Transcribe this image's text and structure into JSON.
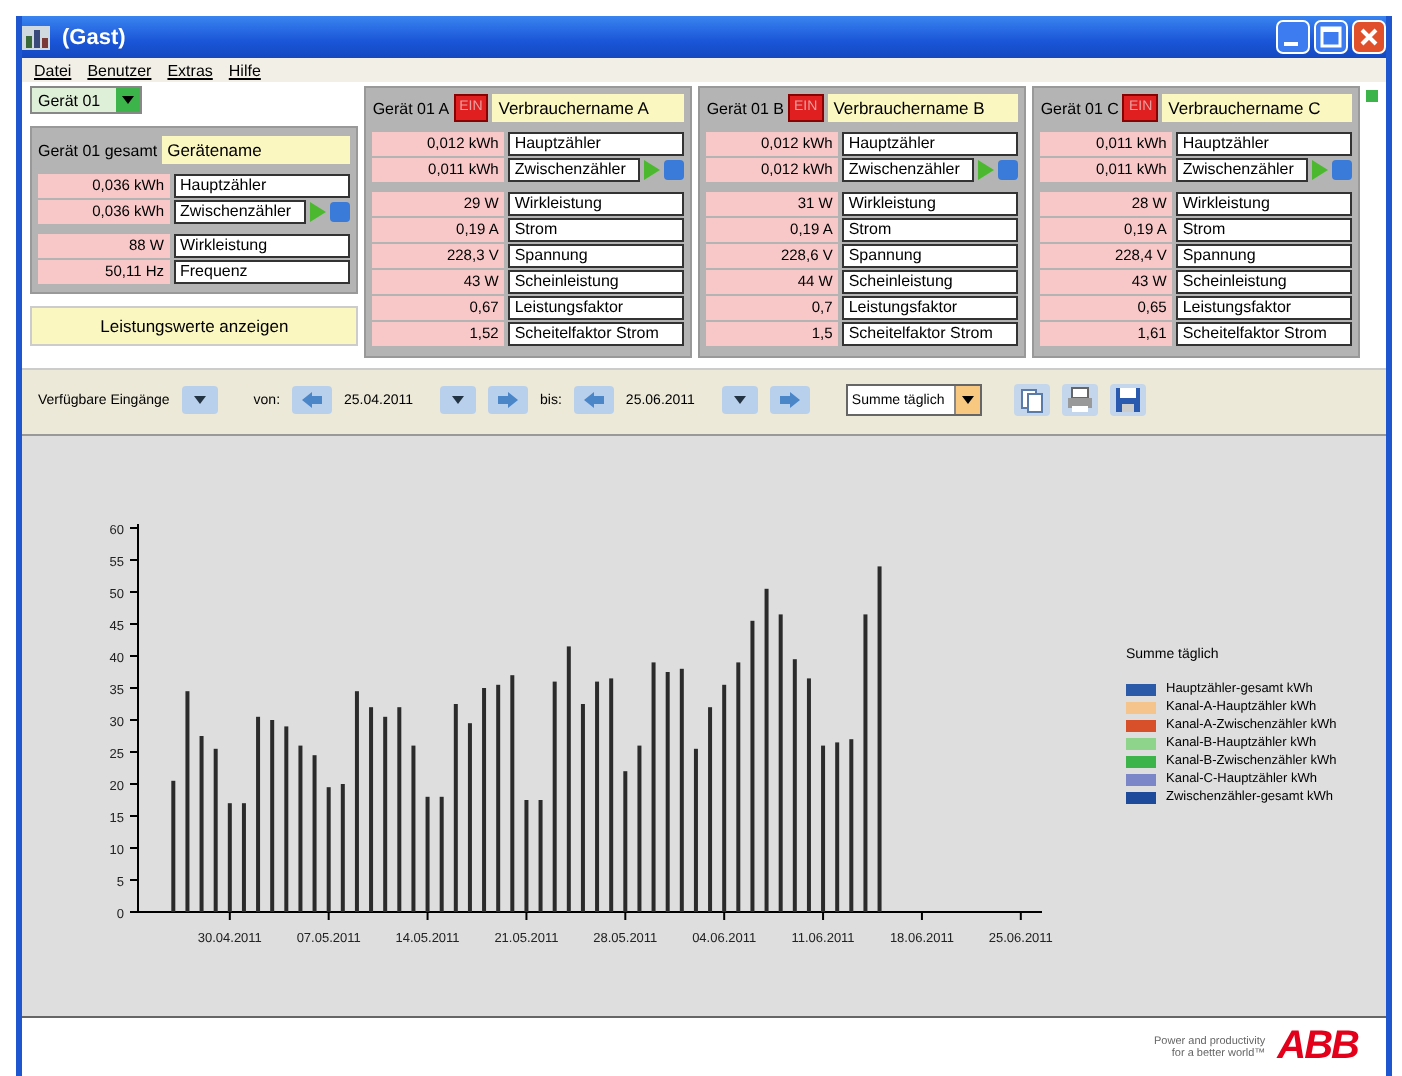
{
  "window": {
    "title": "(Gast)"
  },
  "menu": [
    "Datei",
    "Benutzer",
    "Extras",
    "Hilfe"
  ],
  "device_select": {
    "value": "Gerät 01"
  },
  "total_panel": {
    "label": "Gerät 01 gesamt",
    "name": "Gerätename",
    "counters": [
      {
        "value": "0,036 kWh",
        "label": "Hauptzähler",
        "kind": "plain"
      },
      {
        "value": "0,036 kWh",
        "label": "Zwischenzähler",
        "kind": "resettable"
      }
    ],
    "measurements": [
      {
        "value": "88 W",
        "label": "Wirkleistung"
      },
      {
        "value": "50,11 Hz",
        "label": "Frequenz"
      }
    ],
    "button": "Leistungswerte anzeigen"
  },
  "channel_panels": [
    {
      "label": "Gerät 01 A",
      "status": "EIN",
      "on": true,
      "name": "Verbrauchername A",
      "counters": [
        {
          "value": "0,012 kWh",
          "label": "Hauptzähler",
          "kind": "plain"
        },
        {
          "value": "0,011 kWh",
          "label": "Zwischenzähler",
          "kind": "resettable"
        }
      ],
      "measurements": [
        {
          "value": "29 W",
          "label": "Wirkleistung"
        },
        {
          "value": "0,19 A",
          "label": "Strom"
        },
        {
          "value": "228,3 V",
          "label": "Spannung"
        },
        {
          "value": "43 W",
          "label": "Scheinleistung"
        },
        {
          "value": "0,67",
          "label": "Leistungsfaktor"
        },
        {
          "value": "1,52",
          "label": "Scheitelfaktor Strom"
        }
      ]
    },
    {
      "label": "Gerät 01 B",
      "status": "EIN",
      "on": true,
      "name": "Verbrauchername B",
      "counters": [
        {
          "value": "0,012 kWh",
          "label": "Hauptzähler",
          "kind": "plain"
        },
        {
          "value": "0,012 kWh",
          "label": "Zwischenzähler",
          "kind": "resettable"
        }
      ],
      "measurements": [
        {
          "value": "31 W",
          "label": "Wirkleistung"
        },
        {
          "value": "0,19 A",
          "label": "Strom"
        },
        {
          "value": "228,6 V",
          "label": "Spannung"
        },
        {
          "value": "44 W",
          "label": "Scheinleistung"
        },
        {
          "value": "0,7",
          "label": "Leistungsfaktor"
        },
        {
          "value": "1,5",
          "label": "Scheitelfaktor Strom"
        }
      ]
    },
    {
      "label": "Gerät 01 C",
      "status": "EIN",
      "on": true,
      "name": "Verbrauchername C",
      "counters": [
        {
          "value": "0,011 kWh",
          "label": "Hauptzähler",
          "kind": "plain"
        },
        {
          "value": "0,011 kWh",
          "label": "Zwischenzähler",
          "kind": "resettable"
        }
      ],
      "measurements": [
        {
          "value": "28 W",
          "label": "Wirkleistung"
        },
        {
          "value": "0,19 A",
          "label": "Strom"
        },
        {
          "value": "228,4 V",
          "label": "Spannung"
        },
        {
          "value": "43 W",
          "label": "Scheinleistung"
        },
        {
          "value": "0,65",
          "label": "Leistungsfaktor"
        },
        {
          "value": "1,61",
          "label": "Scheitelfaktor Strom"
        }
      ]
    }
  ],
  "toolbar": {
    "inputs_label": "Verfügbare Eingänge",
    "from_label": "von:",
    "from_date": "25.04.2011",
    "to_label": "bis:",
    "to_date": "25.06.2011",
    "aggregation": "Summe täglich"
  },
  "chart_data": {
    "type": "bar",
    "categories": [
      null,
      null,
      null,
      null,
      null,
      null,
      "30.04.2011",
      null,
      null,
      null,
      null,
      null,
      null,
      "07.05.2011",
      null,
      null,
      null,
      null,
      null,
      null,
      "14.05.2011",
      null,
      null,
      null,
      null,
      null,
      null,
      "21.05.2011",
      null,
      null,
      null,
      null,
      null,
      null,
      "28.05.2011",
      null,
      null,
      null,
      null,
      null,
      null,
      "04.06.2011",
      null,
      null,
      null,
      null,
      null,
      null,
      "11.06.2011",
      null,
      null,
      null,
      null,
      null,
      null,
      "18.06.2011",
      null,
      null,
      null,
      null,
      null,
      null,
      "25.06.2011",
      null
    ],
    "values": [
      null,
      null,
      20.5,
      34.5,
      27.5,
      25.5,
      17,
      17,
      30.5,
      30,
      29,
      26,
      24.5,
      19.5,
      20,
      34.5,
      32,
      30.5,
      32,
      26,
      18,
      18,
      32.5,
      29.5,
      35,
      35.5,
      37,
      17.5,
      17.5,
      36,
      41.5,
      32.5,
      36,
      36.5,
      22,
      26,
      39,
      37.5,
      38,
      25.5,
      32,
      35.5,
      39,
      45.5,
      50.5,
      46.5,
      39.5,
      36.5,
      26,
      26.5,
      27,
      46.5,
      54,
      null,
      null,
      null,
      null,
      null,
      null,
      null,
      null,
      null,
      null,
      null
    ],
    "ylim": [
      0,
      60
    ],
    "yticks": [
      0,
      5,
      10,
      15,
      20,
      25,
      30,
      35,
      40,
      45,
      50,
      55,
      60
    ]
  },
  "legend": {
    "title": "Summe täglich",
    "items": [
      {
        "label": "Hauptzähler-gesamt kWh",
        "color": "#2a5aa8"
      },
      {
        "label": "Kanal-A-Hauptzähler kWh",
        "color": "#f4c48c"
      },
      {
        "label": "Kanal-A-Zwischenzähler kWh",
        "color": "#d8502a"
      },
      {
        "label": "Kanal-B-Hauptzähler kWh",
        "color": "#8ed48a"
      },
      {
        "label": "Kanal-B-Zwischenzähler kWh",
        "color": "#3cb44a"
      },
      {
        "label": "Kanal-C-Hauptzähler kWh",
        "color": "#7a86c8"
      },
      {
        "label": "Zwischenzähler-gesamt kWh",
        "color": "#1e4a9c"
      }
    ]
  },
  "footer": {
    "tagline": [
      "Power and productivity",
      "for a better world™"
    ],
    "logo": "ABB"
  }
}
